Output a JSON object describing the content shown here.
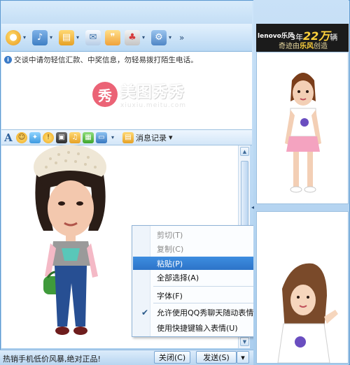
{
  "window": {
    "notice": "交谈中请勿轻信汇款、中奖信息，勿轻易拨打陌生电话。",
    "watermark": {
      "seal": "秀",
      "title": "美图秀秀",
      "url": "xiuxiu.meitu.com"
    }
  },
  "toolbar": {
    "icons": [
      "video-call-icon",
      "voice-call-icon",
      "file-transfer-icon",
      "email-icon",
      "chat-bubble-icon",
      "app-icon",
      "remote-assist-icon"
    ],
    "more": "»"
  },
  "input_toolbar": {
    "icons": [
      "font-icon",
      "emoticon-icon",
      "magic-face-icon",
      "nudge-icon",
      "screenshot-icon",
      "music-icon",
      "image-icon",
      "display-icon",
      "history-icon"
    ],
    "font_glyph": "A",
    "history_label": "消息记录",
    "history_caret": "▾"
  },
  "context_menu": {
    "items": [
      {
        "label": "剪切(T)",
        "state": "disabled"
      },
      {
        "label": "复制(C)",
        "state": "disabled"
      },
      {
        "label": "粘贴(P)",
        "state": "highlighted"
      },
      {
        "label": "全部选择(A)",
        "state": "normal"
      },
      {
        "label": "字体(F)",
        "state": "normal"
      },
      {
        "label": "允许使用QQ秀聊天随动表情",
        "state": "checked"
      },
      {
        "label": "使用快捷键输入表情(U)",
        "state": "normal"
      }
    ],
    "check_glyph": "✔"
  },
  "bottom_bar": {
    "ad_text": "热销手机低价风暴,绝对正品!",
    "close_label": "关闭(C)",
    "send_label": "发送(S)",
    "send_arrow": "▾"
  },
  "right_panel": {
    "ad": {
      "brand": "lenovo乐风",
      "line1_prefix": "3年",
      "line1_big": "22万",
      "line1_suffix": "辆",
      "line2_prefix": "奇迹由",
      "line2_brand": "乐风",
      "line2_suffix": "创造"
    },
    "collapse_arrow": "◂"
  },
  "colors": {
    "frame": "#a9cdee",
    "highlight": "#2d74c8",
    "watermark_seal": "#e8485f"
  }
}
